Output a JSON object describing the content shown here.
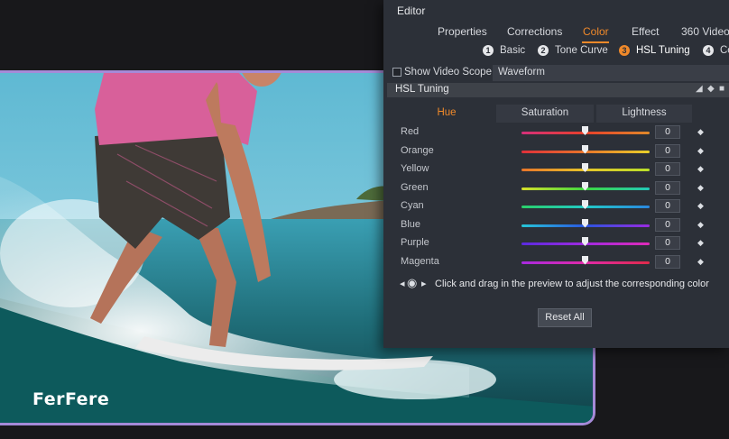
{
  "brand": "FerFere",
  "editor": {
    "title": "Editor",
    "tabs": [
      {
        "label": "Properties"
      },
      {
        "label": "Corrections"
      },
      {
        "label": "Color"
      },
      {
        "label": "Effect"
      },
      {
        "label": "360 Video"
      }
    ],
    "active_tab": "Color",
    "subtabs": [
      {
        "num": "1",
        "label": "Basic"
      },
      {
        "num": "2",
        "label": "Tone Curve"
      },
      {
        "num": "3",
        "label": "HSL Tuning"
      },
      {
        "num": "4",
        "label": "Co"
      }
    ],
    "active_subtab": "HSL Tuning",
    "scope": {
      "checkbox_label": "Show Video Scope",
      "checked": false,
      "select_value": "Waveform"
    },
    "hsl": {
      "title": "HSL Tuning",
      "columns": [
        "Hue",
        "Saturation",
        "Lightness"
      ],
      "active_column": "Hue",
      "rows": [
        {
          "name": "Red",
          "value": "0",
          "colors": [
            "#d4307a",
            "#e8402a",
            "#e0892a"
          ]
        },
        {
          "name": "Orange",
          "value": "0",
          "colors": [
            "#e0303a",
            "#e8762a",
            "#e8d12a"
          ]
        },
        {
          "name": "Yellow",
          "value": "0",
          "colors": [
            "#e8752a",
            "#e6c52a",
            "#b9e02a"
          ]
        },
        {
          "name": "Green",
          "value": "0",
          "colors": [
            "#d8e02a",
            "#3cd640",
            "#22c9b8"
          ]
        },
        {
          "name": "Cyan",
          "value": "0",
          "colors": [
            "#2ad06a",
            "#22c9c6",
            "#2a88e0"
          ]
        },
        {
          "name": "Blue",
          "value": "0",
          "colors": [
            "#26c6d8",
            "#2a55e0",
            "#9a2ae0"
          ]
        },
        {
          "name": "Purple",
          "value": "0",
          "colors": [
            "#5a2ae0",
            "#a02ae0",
            "#e02ab8"
          ]
        },
        {
          "name": "Magenta",
          "value": "0",
          "colors": [
            "#a82ae0",
            "#e02aa8",
            "#e02a4a"
          ]
        }
      ],
      "hint": "Click and drag in the preview to adjust the corresponding color",
      "reset_label": "Reset All"
    }
  }
}
